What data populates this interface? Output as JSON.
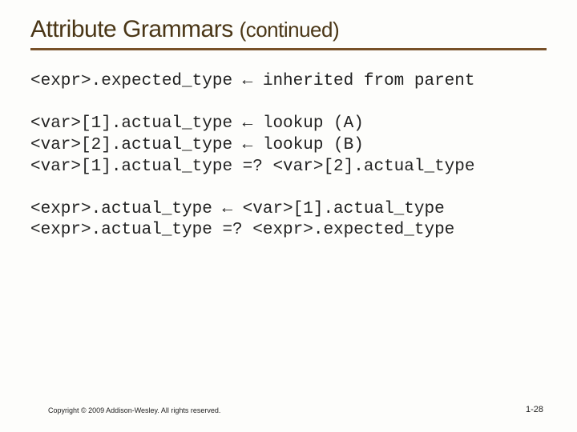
{
  "title_main": "Attribute Grammars ",
  "title_sub": "(continued)",
  "block1": {
    "l1": "<expr>.expected_type ← inherited from parent"
  },
  "block2": {
    "l1": "<var>[1].actual_type ← lookup (A)",
    "l2": "<var>[2].actual_type ← lookup (B)",
    "l3": "<var>[1].actual_type =? <var>[2].actual_type"
  },
  "block3": {
    "l1": "<expr>.actual_type ← <var>[1].actual_type",
    "l2": "<expr>.actual_type =? <expr>.expected_type"
  },
  "copyright": "Copyright © 2009 Addison-Wesley. All rights reserved.",
  "pagenum": "1-28"
}
